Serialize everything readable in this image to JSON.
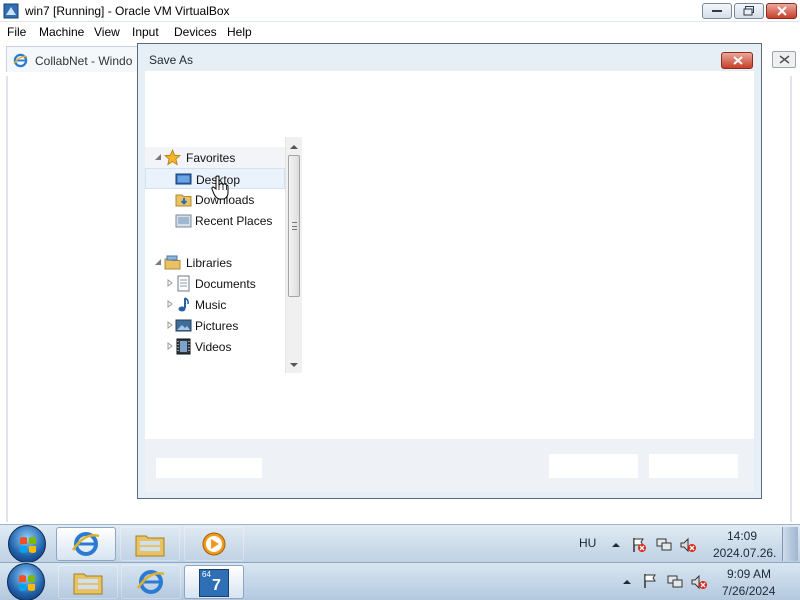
{
  "host_window": {
    "title": "win7 [Running] - Oracle VM VirtualBox",
    "controls": {
      "minimize": "minimize-icon",
      "maximize": "maximize-icon",
      "close": "close-icon"
    }
  },
  "host_menu": {
    "items": [
      {
        "label": "File"
      },
      {
        "label": "Machine"
      },
      {
        "label": "View"
      },
      {
        "label": "Input"
      },
      {
        "label": "Devices"
      },
      {
        "label": "Help"
      }
    ]
  },
  "guest_browser": {
    "tab_label": "CollabNet - Windo",
    "icon": "ie-icon"
  },
  "save_dialog": {
    "title": "Save As",
    "nav": {
      "favorites": "Favorites",
      "desktop": "Desktop",
      "downloads": "Downloads",
      "recent_places": "Recent Places",
      "libraries": "Libraries",
      "documents": "Documents",
      "music": "Music",
      "pictures": "Pictures",
      "videos": "Videos"
    }
  },
  "guest_taskbar": {
    "language": "HU",
    "time": "14:09",
    "date": "2024.07.26."
  },
  "host_taskbar": {
    "time": "9:09 AM",
    "date": "7/26/2024",
    "vbox_badge": "64",
    "vbox_digit": "7"
  },
  "colors": {
    "accent": "#1f5fa8",
    "close_red": "#c7402a",
    "selection": "#eaf3fb"
  }
}
